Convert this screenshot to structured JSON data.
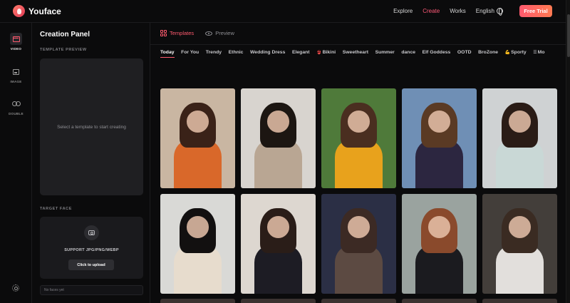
{
  "header": {
    "brand": "Youface",
    "nav": [
      {
        "label": "Explore",
        "active": false
      },
      {
        "label": "Create",
        "active": true
      },
      {
        "label": "Works",
        "active": false
      }
    ],
    "language": "English",
    "free_trial": "Free Trial",
    "accent": "#ff5a6e"
  },
  "rail": {
    "items": [
      {
        "label": "VIDEO",
        "icon": "video-icon",
        "active": true
      },
      {
        "label": "IMAGE",
        "icon": "image-icon",
        "active": false
      },
      {
        "label": "DOUBLE",
        "icon": "double-icon",
        "active": false
      }
    ],
    "settings_icon": "gear-icon"
  },
  "panel": {
    "title": "Creation Panel",
    "template_preview_label": "TEMPLATE PREVIEW",
    "preview_placeholder": "Select a template to start creating",
    "target_face_label": "TARGET FACE",
    "support_text": "SUPPORT JPG/PNG/WEBP",
    "upload_button": "Click to upload",
    "faces_status": "No faces yet"
  },
  "main": {
    "tabs": [
      {
        "label": "Templates",
        "icon": "grid-icon",
        "active": true
      },
      {
        "label": "Preview",
        "icon": "eye-icon",
        "active": false
      }
    ],
    "categories": [
      {
        "label": "Today",
        "active": true,
        "emoji": ""
      },
      {
        "label": "For You",
        "active": false,
        "emoji": ""
      },
      {
        "label": "Trendy",
        "active": false,
        "emoji": ""
      },
      {
        "label": "Ethnic",
        "active": false,
        "emoji": ""
      },
      {
        "label": "Wedding Dress",
        "active": false,
        "emoji": ""
      },
      {
        "label": "Elegant",
        "active": false,
        "emoji": ""
      },
      {
        "label": "Bikini",
        "active": false,
        "emoji": "👙"
      },
      {
        "label": "Sweetheart",
        "active": false,
        "emoji": ""
      },
      {
        "label": "Summer",
        "active": false,
        "emoji": ""
      },
      {
        "label": "dance",
        "active": false,
        "emoji": ""
      },
      {
        "label": "Elf Goddess",
        "active": false,
        "emoji": ""
      },
      {
        "label": "OOTD",
        "active": false,
        "emoji": ""
      },
      {
        "label": "BroZone",
        "active": false,
        "emoji": ""
      },
      {
        "label": "Sporty",
        "active": false,
        "emoji": "💪"
      },
      {
        "label": "Mo",
        "active": false,
        "emoji": "☰"
      }
    ],
    "templates": [
      {
        "bg": "#c9b6a2",
        "hair": "#3a2218",
        "body": "#d9682a"
      },
      {
        "bg": "#d8d4cf",
        "hair": "#1c1612",
        "body": "#b9a693"
      },
      {
        "bg": "#4f7a3a",
        "hair": "#4a2e20",
        "body": "#e8a21c"
      },
      {
        "bg": "#6f8fb5",
        "hair": "#5a3a24",
        "body": "#2c2640"
      },
      {
        "bg": "#cfd2d3",
        "hair": "#2a1c16",
        "body": "#c9d8d6"
      },
      {
        "bg": "#d9d9d6",
        "hair": "#121010",
        "body": "#e7dccd"
      },
      {
        "bg": "#ddd7d0",
        "hair": "#2a1d18",
        "body": "#1d1c24"
      },
      {
        "bg": "#2b2f45",
        "hair": "#3c2a24",
        "body": "#5c4a42"
      },
      {
        "bg": "#9aa39f",
        "hair": "#8a4a2c",
        "body": "#1b1b1f"
      },
      {
        "bg": "#433e3a",
        "hair": "#3a2b22",
        "body": "#e2dfdc"
      }
    ]
  }
}
